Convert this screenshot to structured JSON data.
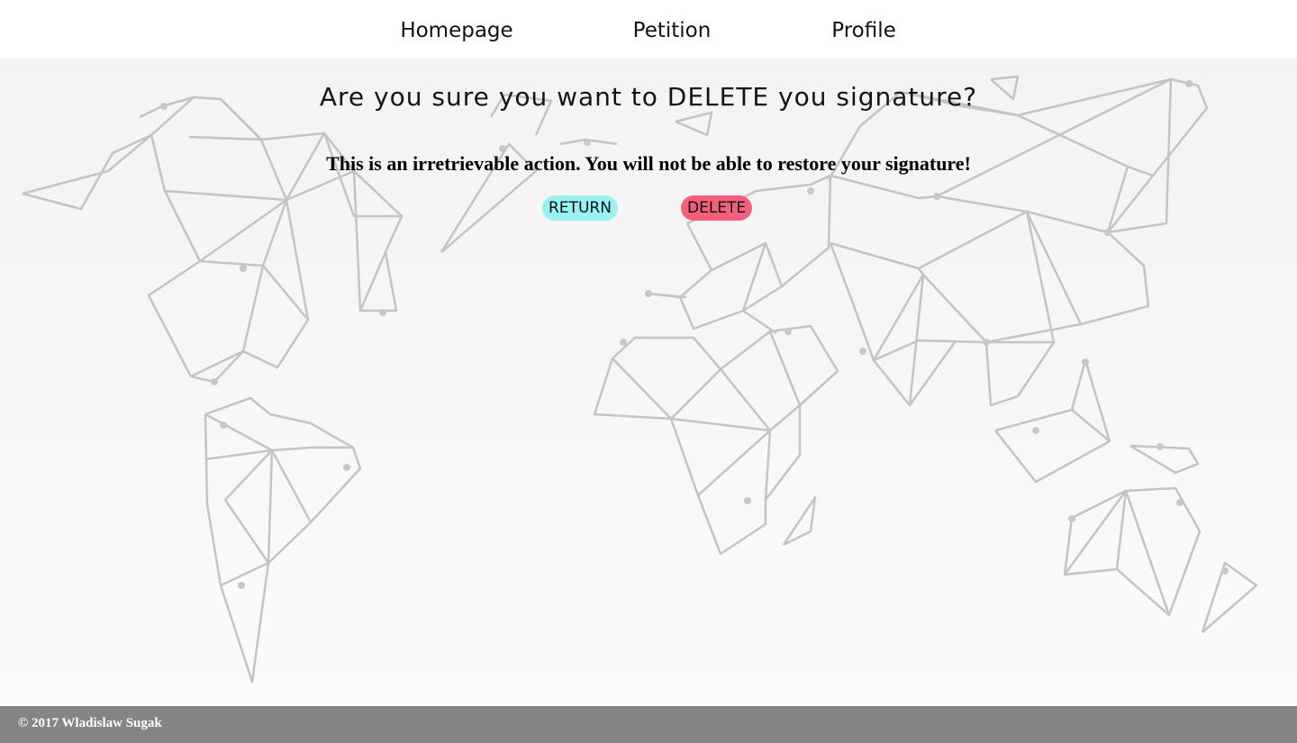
{
  "nav": {
    "items": [
      {
        "label": "Homepage"
      },
      {
        "label": "Petition"
      },
      {
        "label": "Profile"
      }
    ]
  },
  "main": {
    "heading": "Are you sure you want to DELETE you signature?",
    "warning": "This is an irretrievable action. You will not be able to restore your signature!",
    "return_label": "RETURN",
    "delete_label": "DELETE"
  },
  "footer": {
    "copyright": "© 2017 Wladislaw Sugak"
  },
  "colors": {
    "return_button": "#99f1f2",
    "delete_button": "#f2607e",
    "footer": "#858585",
    "map_lines": "#c4c4c4"
  },
  "background": {
    "icon": "geometric-world-map"
  }
}
